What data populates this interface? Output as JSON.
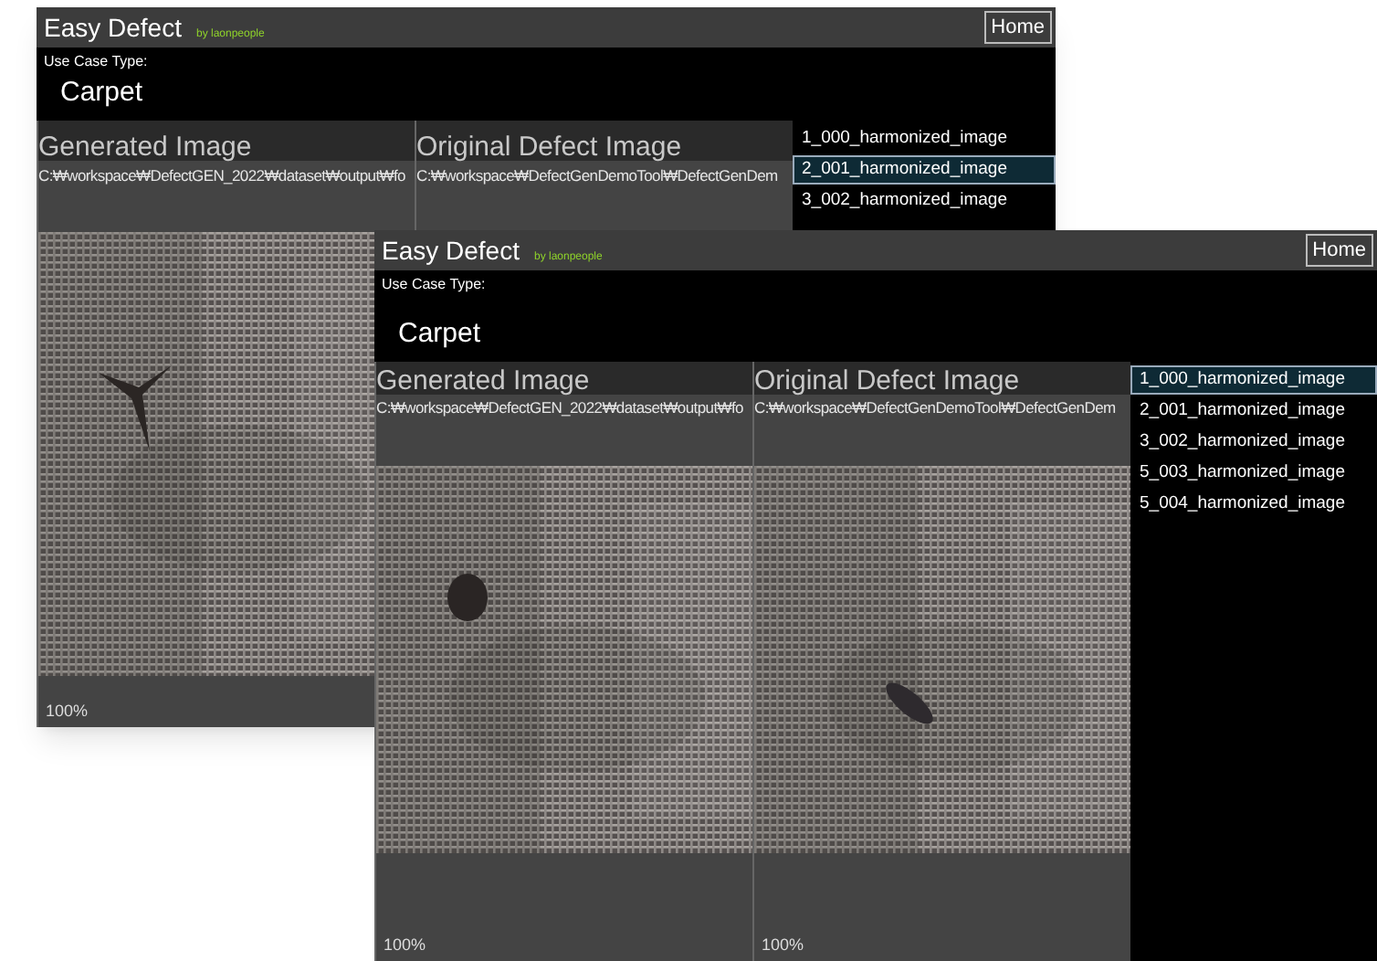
{
  "windows": [
    {
      "title": "Easy Defect",
      "subtitle": "by laonpeople",
      "home_button": "Home",
      "use_case_label": "Use Case Type:",
      "use_case_value": "Carpet",
      "panels": [
        {
          "title": "Generated Image",
          "path": "C:₩workspace₩DefectGEN_2022₩dataset₩output₩fo",
          "zoom": "100%"
        },
        {
          "title": "Original Defect Image",
          "path": "C:₩workspace₩DefectGenDemoTool₩DefectGenDem"
        }
      ],
      "list": [
        {
          "label": "1_000_harmonized_image",
          "selected": false
        },
        {
          "label": "2_001_harmonized_image",
          "selected": true
        },
        {
          "label": "3_002_harmonized_image",
          "selected": false
        }
      ]
    },
    {
      "title": "Easy Defect",
      "subtitle": "by laonpeople",
      "home_button": "Home",
      "use_case_label": "Use Case Type:",
      "use_case_value": "Carpet",
      "panels": [
        {
          "title": "Generated Image",
          "path": "C:₩workspace₩DefectGEN_2022₩dataset₩output₩fo",
          "zoom": "100%"
        },
        {
          "title": "Original Defect Image",
          "path": "C:₩workspace₩DefectGenDemoTool₩DefectGenDem",
          "zoom": "100%"
        }
      ],
      "list": [
        {
          "label": "1_000_harmonized_image",
          "selected": true
        },
        {
          "label": "2_001_harmonized_image",
          "selected": false
        },
        {
          "label": "3_002_harmonized_image",
          "selected": false
        },
        {
          "label": "5_003_harmonized_image",
          "selected": false
        },
        {
          "label": "5_004_harmonized_image",
          "selected": false
        }
      ]
    }
  ]
}
